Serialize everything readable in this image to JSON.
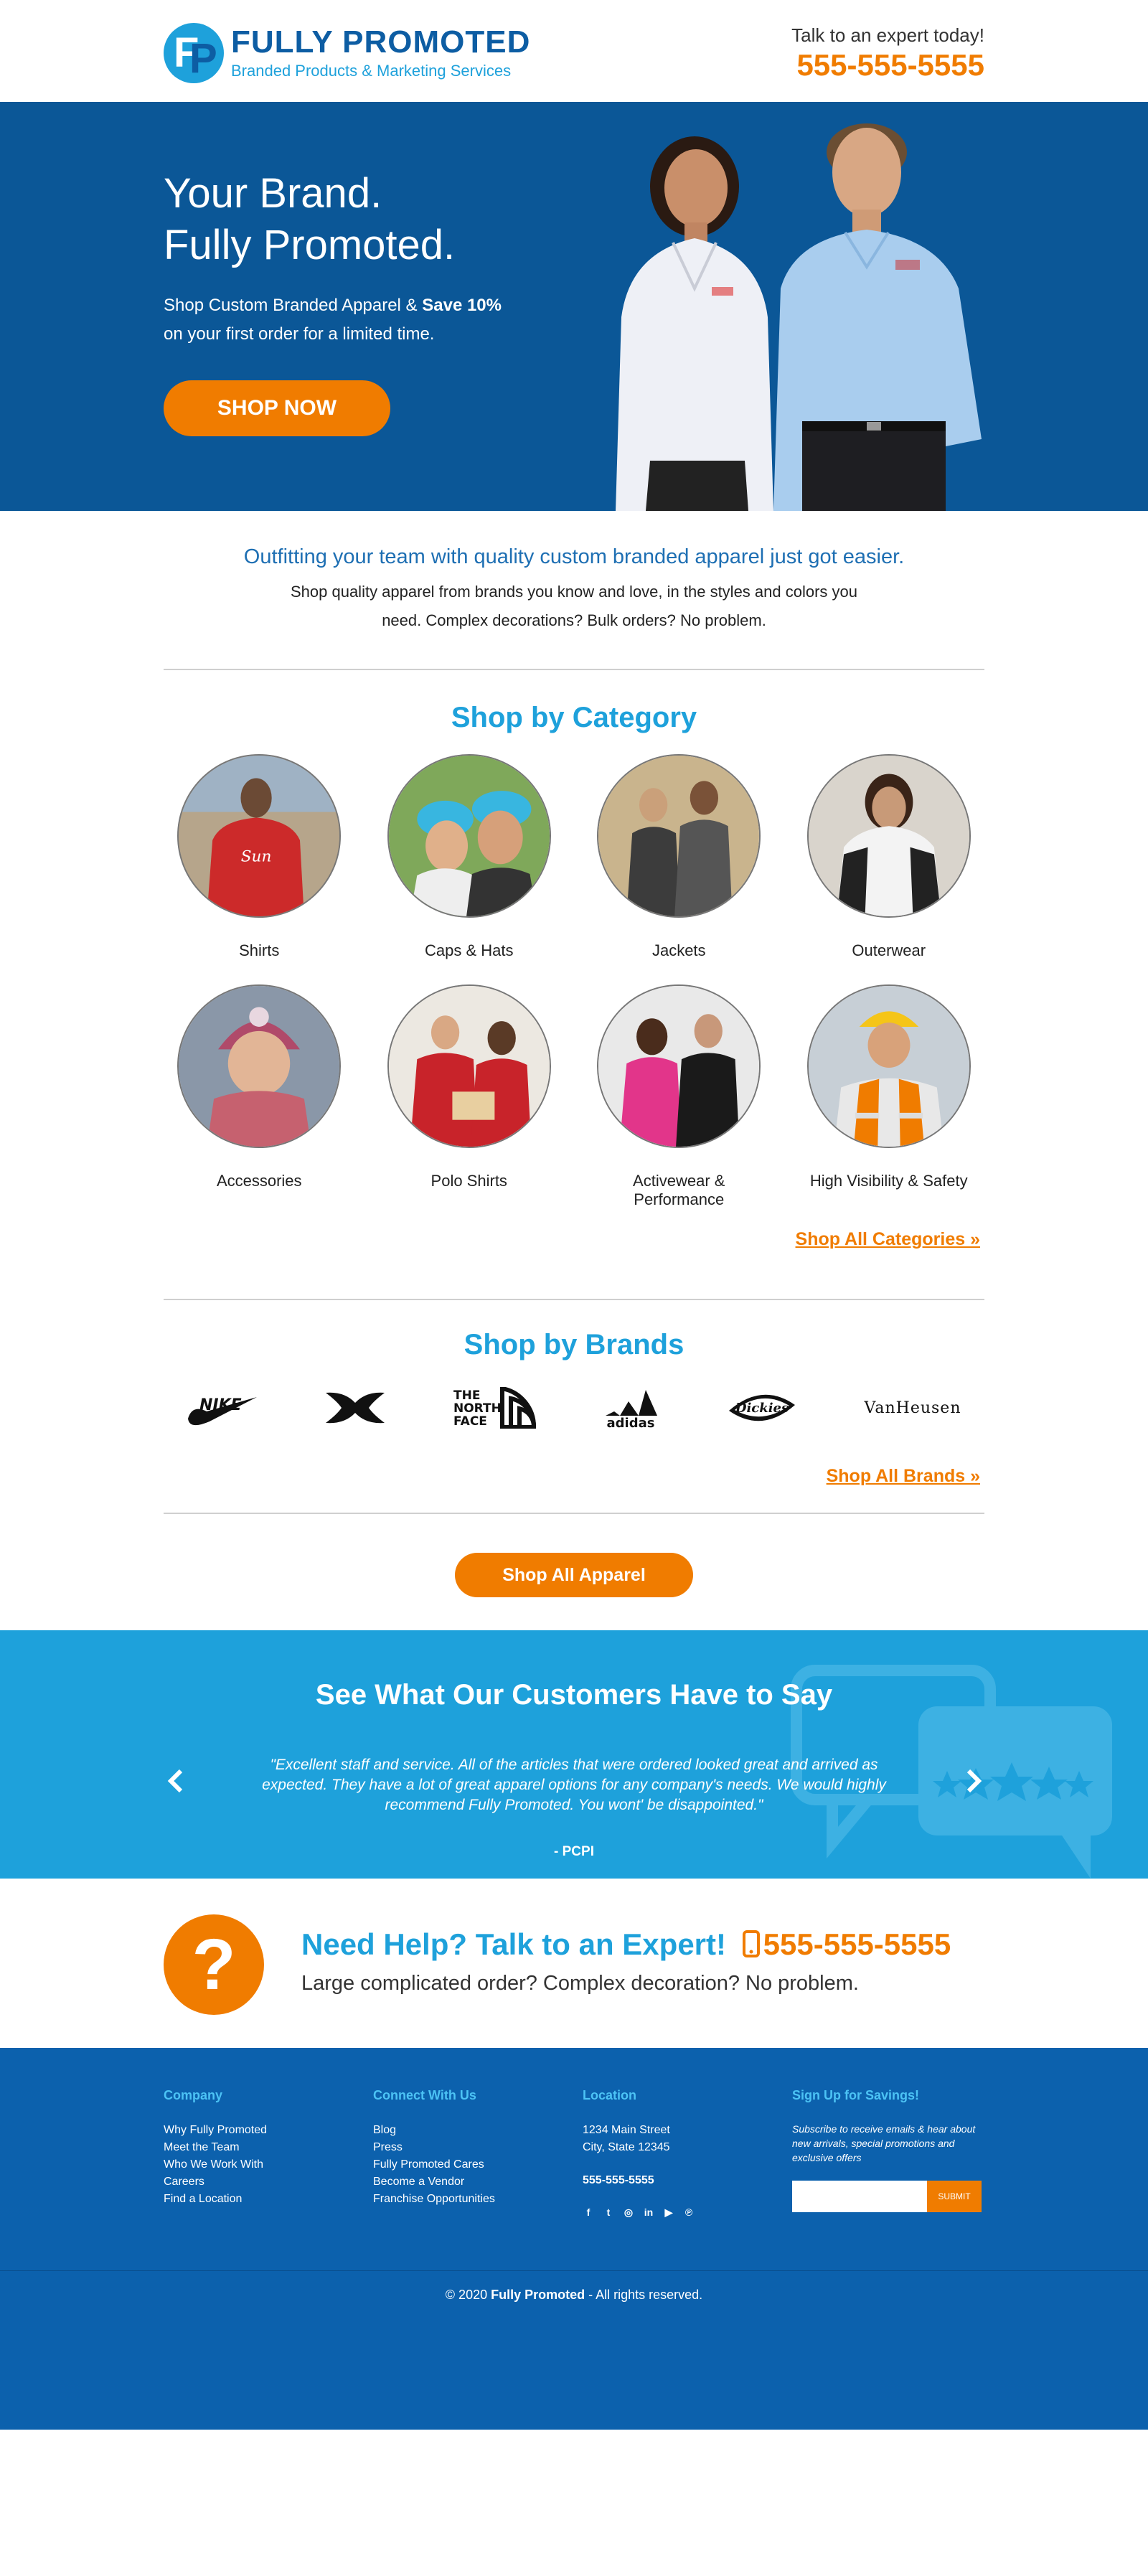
{
  "header": {
    "logo_name": "FULLY PROMOTED",
    "logo_tagline": "Branded Products & Marketing Services",
    "contact_label": "Talk to an expert today!",
    "contact_phone": "555-555-5555"
  },
  "hero": {
    "title_line1": "Your Brand.",
    "title_line2": "Fully Promoted.",
    "sub_prefix": "Shop Custom Branded Apparel & ",
    "sub_bold": "Save 10%",
    "sub_line2": "on your first order for a limited time.",
    "button": "SHOP NOW"
  },
  "intro": {
    "heading": "Outfitting your team with quality custom branded apparel just got easier.",
    "body_line1": "Shop quality apparel from brands you know and love, in the styles and colors you",
    "body_line2": "need. Complex decorations? Bulk orders? No problem."
  },
  "categories": {
    "title": "Shop by Category",
    "items": [
      {
        "label": "Shirts"
      },
      {
        "label": "Caps & Hats"
      },
      {
        "label": "Jackets"
      },
      {
        "label": "Outerwear"
      },
      {
        "label": "Accessories"
      },
      {
        "label": "Polo Shirts"
      },
      {
        "label": "Activewear &",
        "label2": "Performance"
      },
      {
        "label": "High Visibility & Safety"
      }
    ],
    "link": "Shop All Categories »"
  },
  "brands": {
    "title": "Shop by Brands",
    "items": [
      "NIKE",
      "Under Armour",
      "THE NORTH FACE",
      "adidas",
      "Dickies",
      "VANHEUSEN"
    ],
    "north_face_line1": "THE",
    "north_face_line2": "NORTH",
    "north_face_line3": "FACE",
    "adidas_text": "adidas",
    "dickies_text": "Dickies",
    "vanheusen_text": "VanHeusen",
    "link": "Shop All Brands »"
  },
  "shop_all": {
    "button": "Shop All Apparel"
  },
  "testimonials": {
    "title": "See What Our Customers Have to Say",
    "quote": "\"Excellent staff and service. All of the articles that were ordered looked great and arrived as expected. They have a lot of great apparel options for any company's needs. We would highly recommend Fully Promoted. You wont' be disappointed.\"",
    "author": "- PCPI"
  },
  "help": {
    "icon_text": "?",
    "title": "Need Help? Talk to an Expert!",
    "phone": "555-555-5555",
    "sub": "Large complicated order? Complex decoration? No problem."
  },
  "footer": {
    "company_head": "Company",
    "company_links": [
      "Why Fully Promoted",
      "Meet the Team",
      "Who We Work With",
      "Careers",
      "Find a Location"
    ],
    "connect_head": "Connect With Us",
    "connect_links": [
      "Blog",
      "Press",
      "Fully Promoted Cares",
      "Become a Vendor",
      "Franchise Opportunities"
    ],
    "location_head": "Location",
    "address1": "1234 Main Street",
    "address2": "City, State 12345",
    "phone": "555-555-5555",
    "social_icons": [
      "facebook-icon",
      "twitter-icon",
      "instagram-icon",
      "linkedin-icon",
      "youtube-icon",
      "pinterest-icon"
    ],
    "signup_head": "Sign Up for Savings!",
    "signup_text": "Subscribe to receive emails & hear about new arrivals, special promotions and exclusive offers",
    "signup_placeholder": "",
    "signup_button": "SUBMIT",
    "copy_prefix": "© 2020 ",
    "copy_brand": "Fully Promoted",
    "copy_suffix": " - All rights reserved."
  }
}
